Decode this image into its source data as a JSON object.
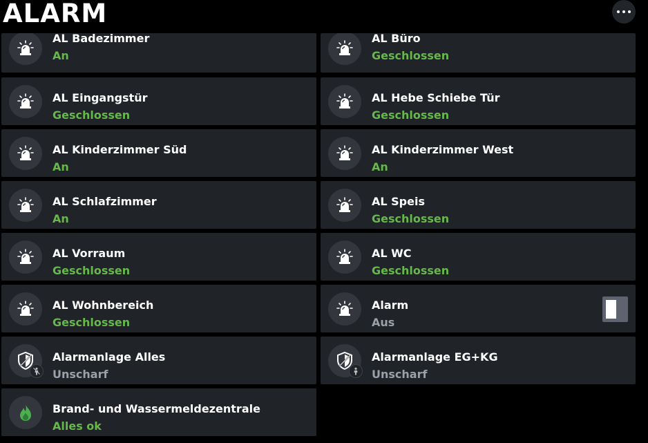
{
  "header": {
    "title": "ALARM",
    "more_icon": "more-horizontal-icon"
  },
  "tiles": [
    {
      "name": "AL Badezimmer",
      "state": "An",
      "icon": "siren-icon",
      "state_color": "#66b84c"
    },
    {
      "name": "AL Büro",
      "state": "Geschlossen",
      "icon": "siren-icon",
      "state_color": "#66b84c"
    },
    {
      "name": "AL Eingangstür",
      "state": "Geschlossen",
      "icon": "siren-icon",
      "state_color": "#66b84c"
    },
    {
      "name": "AL Hebe Schiebe Tür",
      "state": "Geschlossen",
      "icon": "siren-icon",
      "state_color": "#66b84c"
    },
    {
      "name": "AL Kinderzimmer Süd",
      "state": "An",
      "icon": "siren-icon",
      "state_color": "#66b84c"
    },
    {
      "name": "AL Kinderzimmer West",
      "state": "An",
      "icon": "siren-icon",
      "state_color": "#66b84c"
    },
    {
      "name": "AL Schlafzimmer",
      "state": "An",
      "icon": "siren-icon",
      "state_color": "#66b84c"
    },
    {
      "name": "AL Speis",
      "state": "Geschlossen",
      "icon": "siren-icon",
      "state_color": "#66b84c"
    },
    {
      "name": "AL Vorraum",
      "state": "Geschlossen",
      "icon": "siren-icon",
      "state_color": "#66b84c"
    },
    {
      "name": "AL WC",
      "state": "Geschlossen",
      "icon": "siren-icon",
      "state_color": "#66b84c"
    },
    {
      "name": "AL Wohnbereich",
      "state": "Geschlossen",
      "icon": "siren-icon",
      "state_color": "#66b84c"
    },
    {
      "name": "Alarm",
      "state": "Aus",
      "icon": "siren-icon",
      "state_color": "#9aa1ab",
      "toggle": "off"
    },
    {
      "name": "Alarmanlage Alles",
      "state": "Unscharf",
      "icon": "shield-icon",
      "badge_icon": "person-crossed-icon",
      "state_color": "#9aa1ab"
    },
    {
      "name": "Alarmanlage EG+KG",
      "state": "Unscharf",
      "icon": "shield-icon",
      "badge_icon": "person-icon",
      "state_color": "#9aa1ab"
    },
    {
      "name": "Brand- und Wassermeldezentrale",
      "state": "Alles ok",
      "icon": "flame-icon",
      "state_color": "#66b84c"
    }
  ],
  "colors": {
    "background": "#000000",
    "tile": "#202327",
    "icon_circle": "#33373d",
    "ok": "#66b84c",
    "neutral": "#9aa1ab",
    "flame": "#4caf50"
  }
}
